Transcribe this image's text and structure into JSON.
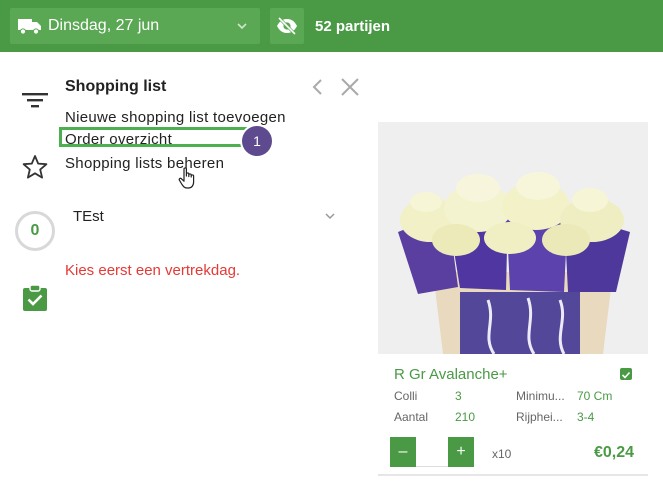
{
  "topbar": {
    "date_label": "Dinsdag, 27 jun",
    "lots_count": "52 partijen"
  },
  "sidebar": {
    "counter": "0"
  },
  "shopping_panel": {
    "title": "Shopping list",
    "menu": [
      "Nieuwe shopping list toevoegen",
      "Order overzicht",
      "Shopping lists beheren"
    ],
    "step_badge": "1",
    "selected_list": "TEst",
    "warning": "Kies eerst een vertrekdag."
  },
  "product": {
    "name": "R Gr Avalanche+",
    "props": {
      "colli_label": "Colli",
      "colli_value": "3",
      "aantal_label": "Aantal",
      "aantal_value": "210",
      "minimum_label": "Minimu...",
      "minimum_value": "70 Cm",
      "rijpheid_label": "Rijphei...",
      "rijpheid_value": "3-4"
    },
    "minus": "–",
    "plus": "+",
    "quantity": "",
    "multiplier": "x10",
    "price": "€0,24"
  },
  "colors": {
    "brand_green": "#4a9a45",
    "badge_purple": "#5e4a8e",
    "warning_red": "#e53935",
    "highlight_green": "#4caf50"
  },
  "icons": [
    "truck-icon",
    "chevron-down-icon",
    "eye-off-icon",
    "filter-icon",
    "star-icon",
    "clipboard-check-icon",
    "chevron-left-icon",
    "close-icon",
    "hand-cursor-icon",
    "check-icon"
  ]
}
